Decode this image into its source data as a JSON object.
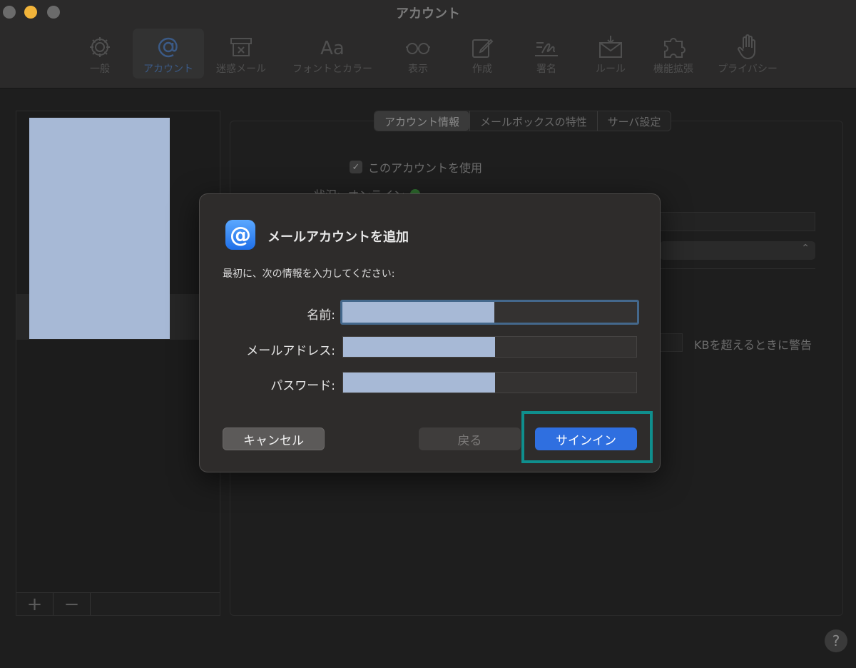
{
  "window": {
    "title": "アカウント"
  },
  "toolbar": {
    "items": [
      {
        "label": "一般",
        "icon": "gear-icon"
      },
      {
        "label": "アカウント",
        "icon": "at-icon"
      },
      {
        "label": "迷惑メール",
        "icon": "junk-icon"
      },
      {
        "label": "フォントとカラー",
        "icon": "font-icon"
      },
      {
        "label": "表示",
        "icon": "glasses-icon"
      },
      {
        "label": "作成",
        "icon": "compose-icon"
      },
      {
        "label": "署名",
        "icon": "signature-icon"
      },
      {
        "label": "ルール",
        "icon": "rules-icon"
      },
      {
        "label": "機能拡張",
        "icon": "puzzle-icon"
      },
      {
        "label": "プライバシー",
        "icon": "hand-icon"
      }
    ],
    "active_index": 1
  },
  "account_list": {
    "add_label": "+",
    "remove_label": "−"
  },
  "settings": {
    "tabs": [
      "アカウント情報",
      "メールボックスの特性",
      "サーバ設定"
    ],
    "active_tab": "アカウント情報",
    "use_account_label": "このアカウントを使用",
    "use_account_checked": true,
    "status_label": "状況:",
    "status_value": "オンライン",
    "kb_warning_label": "KBを超えるときに警告",
    "help_label": "?"
  },
  "dialog": {
    "title": "メールアカウントを追加",
    "instructions": "最初に、次の情報を入力してください:",
    "fields": {
      "name_label": "名前:",
      "email_label": "メールアドレス:",
      "password_label": "パスワード:"
    },
    "buttons": {
      "cancel": "キャンセル",
      "back": "戻る",
      "sign_in": "サインイン"
    }
  },
  "colors": {
    "accent": "#2f6fe0",
    "highlight_box": "#0f8f8d",
    "redaction": "#a7b9d6",
    "status_online": "#2f6e2f"
  }
}
